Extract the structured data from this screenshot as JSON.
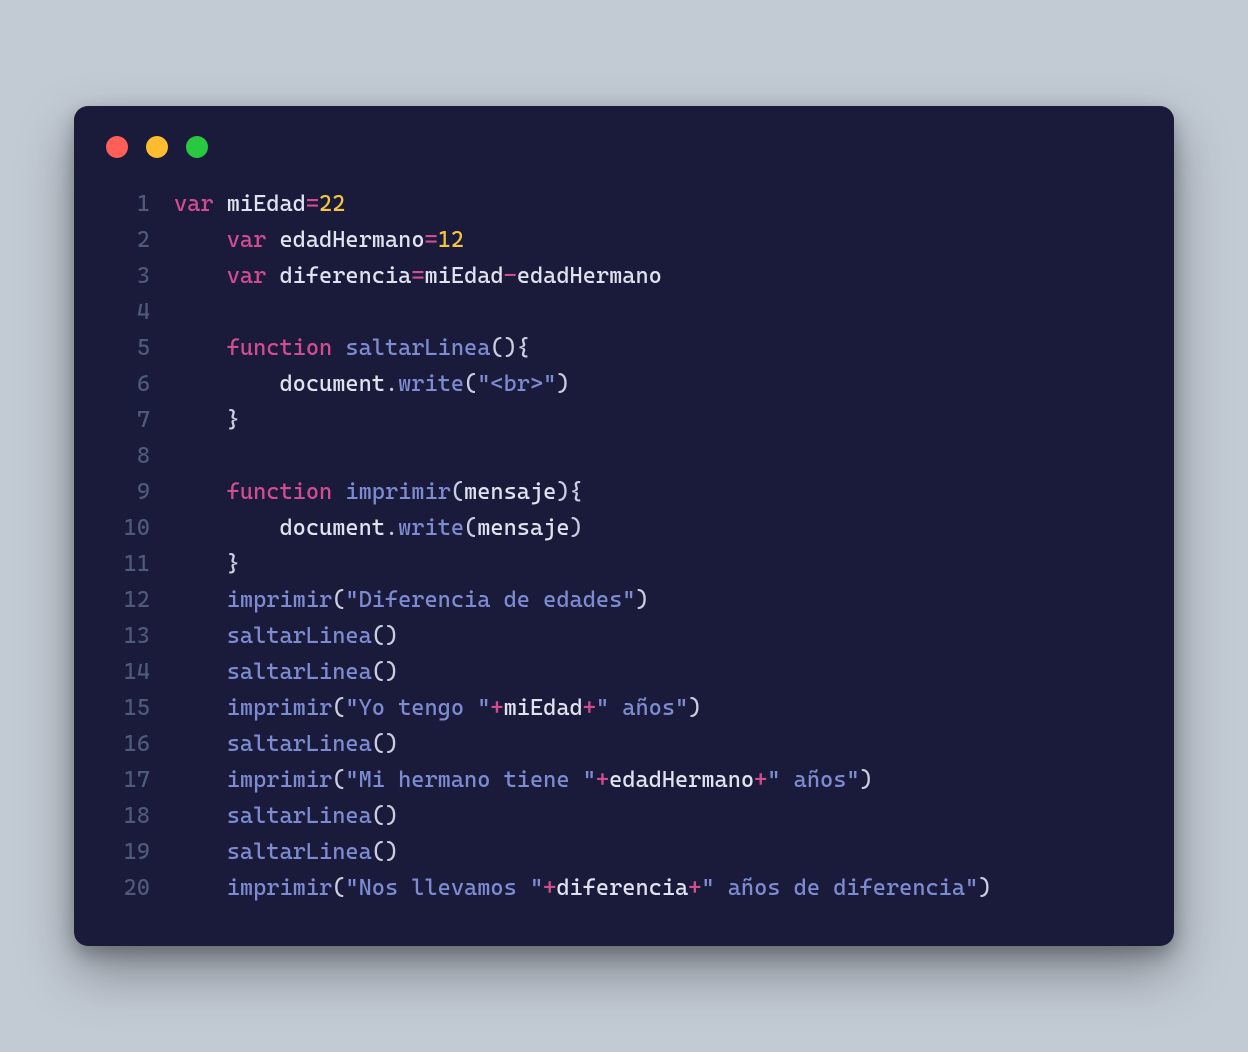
{
  "window": {
    "dots": {
      "red": "#ff5f57",
      "yellow": "#febc2e",
      "green": "#28c840"
    }
  },
  "code": {
    "lines": [
      {
        "n": "1",
        "indent": 0,
        "tokens": [
          {
            "t": "kw",
            "v": "var"
          },
          {
            "t": "plain",
            "v": " "
          },
          {
            "t": "id",
            "v": "miEdad"
          },
          {
            "t": "op",
            "v": "="
          },
          {
            "t": "num",
            "v": "22"
          }
        ]
      },
      {
        "n": "2",
        "indent": 1,
        "tokens": [
          {
            "t": "kw",
            "v": "var"
          },
          {
            "t": "plain",
            "v": " "
          },
          {
            "t": "id",
            "v": "edadHermano"
          },
          {
            "t": "op",
            "v": "="
          },
          {
            "t": "num",
            "v": "12"
          }
        ]
      },
      {
        "n": "3",
        "indent": 1,
        "tokens": [
          {
            "t": "kw",
            "v": "var"
          },
          {
            "t": "plain",
            "v": " "
          },
          {
            "t": "id",
            "v": "diferencia"
          },
          {
            "t": "op",
            "v": "="
          },
          {
            "t": "id",
            "v": "miEdad"
          },
          {
            "t": "op",
            "v": "-"
          },
          {
            "t": "id",
            "v": "edadHermano"
          }
        ]
      },
      {
        "n": "4",
        "indent": 1,
        "tokens": []
      },
      {
        "n": "5",
        "indent": 1,
        "tokens": [
          {
            "t": "kw",
            "v": "function"
          },
          {
            "t": "plain",
            "v": " "
          },
          {
            "t": "fn",
            "v": "saltarLinea"
          },
          {
            "t": "punc",
            "v": "(){"
          }
        ]
      },
      {
        "n": "6",
        "indent": 2,
        "tokens": [
          {
            "t": "id",
            "v": "document"
          },
          {
            "t": "punc",
            "v": "."
          },
          {
            "t": "fn",
            "v": "write"
          },
          {
            "t": "punc",
            "v": "("
          },
          {
            "t": "str",
            "v": "\"<br>\""
          },
          {
            "t": "punc",
            "v": ")"
          }
        ]
      },
      {
        "n": "7",
        "indent": 1,
        "tokens": [
          {
            "t": "punc",
            "v": "}"
          }
        ]
      },
      {
        "n": "8",
        "indent": 1,
        "tokens": []
      },
      {
        "n": "9",
        "indent": 1,
        "tokens": [
          {
            "t": "kw",
            "v": "function"
          },
          {
            "t": "plain",
            "v": " "
          },
          {
            "t": "fn",
            "v": "imprimir"
          },
          {
            "t": "punc",
            "v": "("
          },
          {
            "t": "id",
            "v": "mensaje"
          },
          {
            "t": "punc",
            "v": "){"
          }
        ]
      },
      {
        "n": "10",
        "indent": 2,
        "tokens": [
          {
            "t": "id",
            "v": "document"
          },
          {
            "t": "punc",
            "v": "."
          },
          {
            "t": "fn",
            "v": "write"
          },
          {
            "t": "punc",
            "v": "("
          },
          {
            "t": "id",
            "v": "mensaje"
          },
          {
            "t": "punc",
            "v": ")"
          }
        ]
      },
      {
        "n": "11",
        "indent": 1,
        "tokens": [
          {
            "t": "punc",
            "v": "}"
          }
        ]
      },
      {
        "n": "12",
        "indent": 1,
        "tokens": [
          {
            "t": "fn",
            "v": "imprimir"
          },
          {
            "t": "punc",
            "v": "("
          },
          {
            "t": "str",
            "v": "\"Diferencia de edades\""
          },
          {
            "t": "punc",
            "v": ")"
          }
        ]
      },
      {
        "n": "13",
        "indent": 1,
        "tokens": [
          {
            "t": "fn",
            "v": "saltarLinea"
          },
          {
            "t": "punc",
            "v": "()"
          }
        ]
      },
      {
        "n": "14",
        "indent": 1,
        "tokens": [
          {
            "t": "fn",
            "v": "saltarLinea"
          },
          {
            "t": "punc",
            "v": "()"
          }
        ]
      },
      {
        "n": "15",
        "indent": 1,
        "tokens": [
          {
            "t": "fn",
            "v": "imprimir"
          },
          {
            "t": "punc",
            "v": "("
          },
          {
            "t": "str",
            "v": "\"Yo tengo \""
          },
          {
            "t": "op",
            "v": "+"
          },
          {
            "t": "id",
            "v": "miEdad"
          },
          {
            "t": "op",
            "v": "+"
          },
          {
            "t": "str",
            "v": "\" años\""
          },
          {
            "t": "punc",
            "v": ")"
          }
        ]
      },
      {
        "n": "16",
        "indent": 1,
        "tokens": [
          {
            "t": "fn",
            "v": "saltarLinea"
          },
          {
            "t": "punc",
            "v": "()"
          }
        ]
      },
      {
        "n": "17",
        "indent": 1,
        "tokens": [
          {
            "t": "fn",
            "v": "imprimir"
          },
          {
            "t": "punc",
            "v": "("
          },
          {
            "t": "str",
            "v": "\"Mi hermano tiene \""
          },
          {
            "t": "op",
            "v": "+"
          },
          {
            "t": "id",
            "v": "edadHermano"
          },
          {
            "t": "op",
            "v": "+"
          },
          {
            "t": "str",
            "v": "\" años\""
          },
          {
            "t": "punc",
            "v": ")"
          }
        ]
      },
      {
        "n": "18",
        "indent": 1,
        "tokens": [
          {
            "t": "fn",
            "v": "saltarLinea"
          },
          {
            "t": "punc",
            "v": "()"
          }
        ]
      },
      {
        "n": "19",
        "indent": 1,
        "tokens": [
          {
            "t": "fn",
            "v": "saltarLinea"
          },
          {
            "t": "punc",
            "v": "()"
          }
        ]
      },
      {
        "n": "20",
        "indent": 1,
        "tokens": [
          {
            "t": "fn",
            "v": "imprimir"
          },
          {
            "t": "punc",
            "v": "("
          },
          {
            "t": "str",
            "v": "\"Nos llevamos \""
          },
          {
            "t": "op",
            "v": "+"
          },
          {
            "t": "id",
            "v": "diferencia"
          },
          {
            "t": "op",
            "v": "+"
          },
          {
            "t": "str",
            "v": "\" años de diferencia\""
          },
          {
            "t": "punc",
            "v": ")"
          }
        ]
      }
    ],
    "indentUnit": "    "
  }
}
